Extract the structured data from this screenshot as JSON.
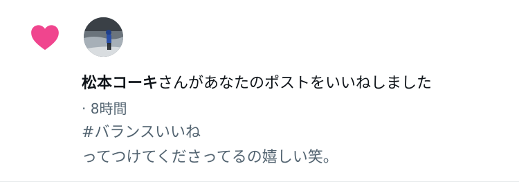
{
  "notification": {
    "icon": "heart-icon",
    "accent_color": "#f0458e",
    "actor_name": "松本コーキ",
    "action_text": "さんがあなたのポストをいいねしました",
    "timestamp": "· 8時間",
    "post": {
      "line1": "#バランスいいね",
      "line2": "ってつけてくださってるの嬉しい笑。"
    }
  }
}
